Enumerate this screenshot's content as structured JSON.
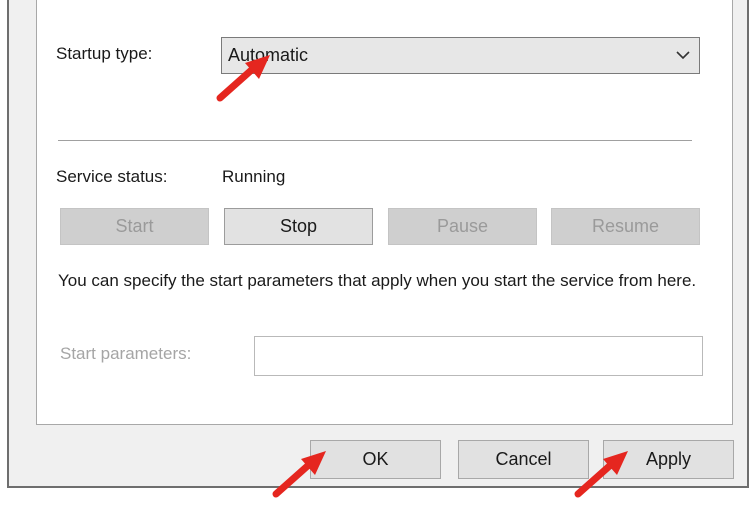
{
  "startup": {
    "label": "Startup type:",
    "selected": "Automatic",
    "chevron_icon": "chevron-down-icon"
  },
  "status": {
    "label": "Service status:",
    "value": "Running"
  },
  "service_buttons": {
    "start": "Start",
    "stop": "Stop",
    "pause": "Pause",
    "resume": "Resume"
  },
  "description": "You can specify the start parameters that apply when you start the service from here.",
  "params": {
    "label": "Start parameters:",
    "value": ""
  },
  "footer": {
    "ok": "OK",
    "cancel": "Cancel",
    "apply": "Apply"
  },
  "colors": {
    "annotation_arrow": "#e5261f",
    "disabled_text": "#9a9a9a",
    "panel_background": "#ffffff",
    "dialog_background": "#f0f0f0"
  }
}
